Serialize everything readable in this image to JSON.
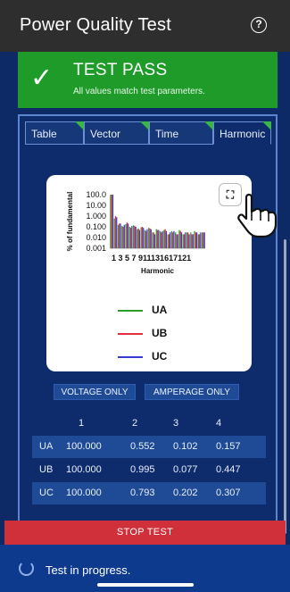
{
  "header": {
    "title": "Power Quality Test",
    "help_icon": "?"
  },
  "result_banner": {
    "check_glyph": "✓",
    "title": "TEST PASS",
    "subtitle": "All values match test parameters.",
    "color": "#1f9b2a"
  },
  "tabs": [
    {
      "label": "Table",
      "active": false
    },
    {
      "label": "Vector",
      "active": false
    },
    {
      "label": "Time",
      "active": false
    },
    {
      "label": "Harmonic",
      "active": true
    }
  ],
  "chart_data": {
    "type": "bar",
    "ylabel": "% of fundamental",
    "xlabel": "Harmonic",
    "y_scale": "log",
    "yticks": [
      "100.0",
      "10.00",
      "1.000",
      "0.100",
      "0.010",
      "0.001"
    ],
    "xticks": [
      "1",
      "3",
      "5",
      "7",
      "9",
      "11",
      "13",
      "15",
      "17",
      "19",
      "21"
    ],
    "x_tick_text": "1 3 5 7 911131617121",
    "categories": [
      1,
      2,
      3,
      4,
      5,
      6,
      7,
      8,
      9,
      10,
      11,
      12,
      13,
      14,
      15,
      16,
      17,
      18,
      19,
      20,
      21,
      22,
      23,
      24,
      25
    ],
    "series": [
      {
        "name": "UA",
        "color": "#2e9b2e",
        "values": [
          100,
          0.6,
          0.15,
          0.12,
          0.18,
          0.1,
          0.14,
          0.06,
          0.09,
          0.05,
          0.08,
          0.03,
          0.06,
          0.04,
          0.05,
          0.02,
          0.04,
          0.03,
          0.05,
          0.02,
          0.03,
          0.03,
          0.04,
          0.02,
          0.03
        ]
      },
      {
        "name": "UB",
        "color": "#e0313d",
        "values": [
          100,
          0.99,
          0.2,
          0.1,
          0.25,
          0.08,
          0.12,
          0.07,
          0.1,
          0.04,
          0.07,
          0.03,
          0.05,
          0.03,
          0.06,
          0.02,
          0.03,
          0.02,
          0.04,
          0.02,
          0.03,
          0.02,
          0.03,
          0.02,
          0.03
        ]
      },
      {
        "name": "UC",
        "color": "#3a3ad6",
        "values": [
          100,
          0.79,
          0.2,
          0.15,
          0.2,
          0.12,
          0.1,
          0.05,
          0.08,
          0.06,
          0.06,
          0.02,
          0.05,
          0.04,
          0.04,
          0.03,
          0.04,
          0.02,
          0.03,
          0.03,
          0.02,
          0.02,
          0.03,
          0.03,
          0.03
        ]
      }
    ],
    "legend": [
      "UA",
      "UB",
      "UC"
    ]
  },
  "filters": {
    "voltage_label": "VOLTAGE ONLY",
    "amperage_label": "AMPERAGE ONLY"
  },
  "table": {
    "headers": [
      "",
      "1",
      "2",
      "3",
      "4"
    ],
    "rows": [
      [
        "UA",
        "100.000",
        "0.552",
        "0.102",
        "0.157"
      ],
      [
        "UB",
        "100.000",
        "0.995",
        "0.077",
        "0.447"
      ],
      [
        "UC",
        "100.000",
        "0.793",
        "0.202",
        "0.307"
      ]
    ]
  },
  "actions": {
    "stop_label": "STOP TEST",
    "stop_color": "#d0303a"
  },
  "status": {
    "text": "Test in progress."
  },
  "icons": {
    "expand": "expand-icon",
    "pointer": "hand-pointer-icon",
    "spinner": "spinner-icon"
  }
}
